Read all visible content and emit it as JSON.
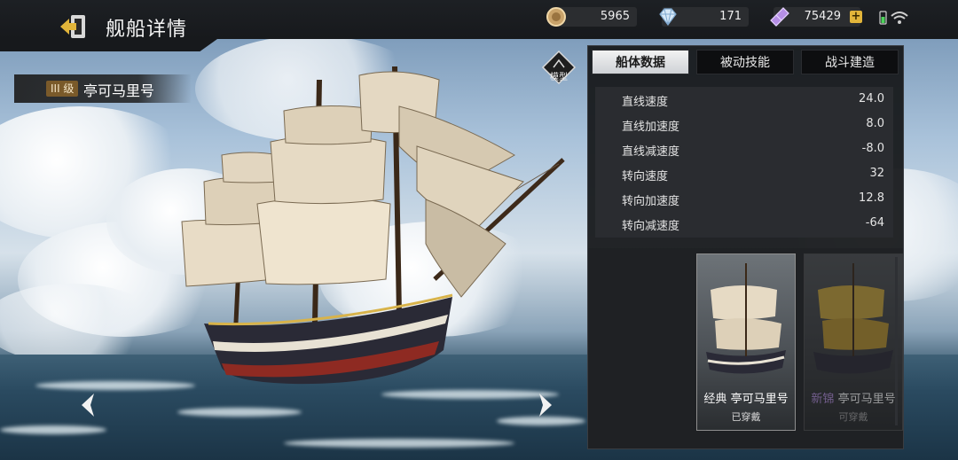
{
  "header": {
    "title": "舰船详情",
    "resources": [
      {
        "icon": "silver-coin-icon",
        "value": "5965"
      },
      {
        "icon": "diamond-icon",
        "value": "171"
      },
      {
        "icon": "ticket-icon",
        "value": "75429",
        "has_plus": true
      }
    ],
    "status": {
      "battery": "battery-icon",
      "wifi": "wifi-icon"
    }
  },
  "ship": {
    "rank": "III 级",
    "name": "亭可马里号",
    "model_label": "模型"
  },
  "tabs": [
    {
      "label": "船体数据",
      "active": true
    },
    {
      "label": "被动技能",
      "active": false
    },
    {
      "label": "战斗建造",
      "active": false
    }
  ],
  "stats": [
    {
      "label": "直线速度",
      "value": "24.0"
    },
    {
      "label": "直线加速度",
      "value": "8.0"
    },
    {
      "label": "直线减速度",
      "value": "-8.0"
    },
    {
      "label": "转向速度",
      "value": "32"
    },
    {
      "label": "转向加速度",
      "value": "12.8"
    },
    {
      "label": "转向减速度",
      "value": "-64"
    }
  ],
  "skins": [
    {
      "tag": "经典",
      "name": "亭可马里号",
      "state": "已穿戴"
    },
    {
      "tag": "新锦",
      "name": "亭可马里号",
      "state": "可穿戴"
    }
  ],
  "colors": {
    "accent_gold": "#e2b53a",
    "panel_bg": "#16181b",
    "skin_purple": "#b58ee0"
  }
}
